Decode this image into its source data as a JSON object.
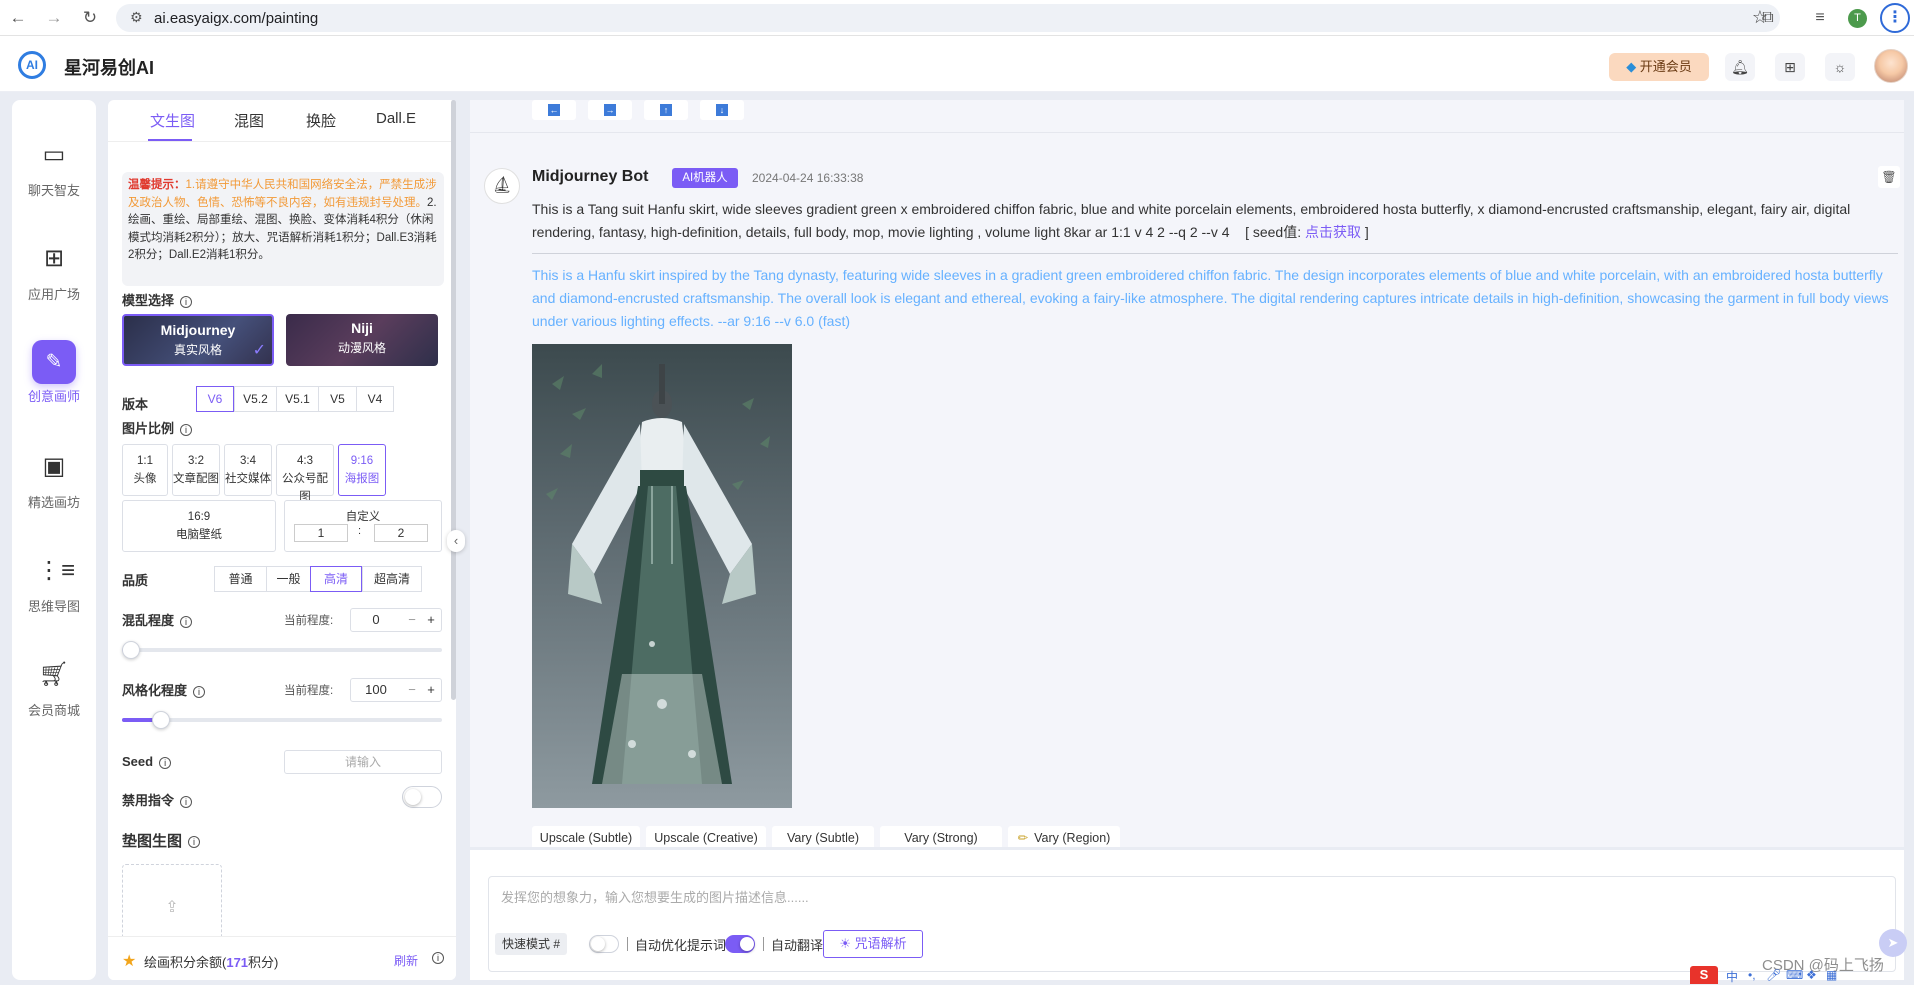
{
  "browser": {
    "url": "ai.easyaigx.com/painting",
    "profile_initial": "T",
    "back_icon": "arrow-left",
    "forward_icon": "arrow-right",
    "reload_icon": "reload"
  },
  "app": {
    "name": "星河易创AI",
    "logo_text": "AI",
    "vip_label": "开通会员"
  },
  "left_nav": [
    {
      "label": "聊天智友",
      "icon": "chat"
    },
    {
      "label": "应用广场",
      "icon": "grid"
    },
    {
      "label": "创意画师",
      "icon": "palette",
      "active": true
    },
    {
      "label": "精选画坊",
      "icon": "gallery"
    },
    {
      "label": "思维导图",
      "icon": "mindmap"
    },
    {
      "label": "会员商城",
      "icon": "cart"
    }
  ],
  "settings": {
    "tabs": [
      "文生图",
      "混图",
      "换脸",
      "Dall.E"
    ],
    "notice": {
      "title": "温馨提示：",
      "warn": "1.请遵守中华人民共和国网络安全法，严禁生成涉及政治人物、色情、恐怖等不良内容，如有违规封号处理。",
      "body": "2.绘画、重绘、局部重绘、混图、换脸、变体消耗4积分（休闲模式均消耗2积分）；放大、咒语解析消耗1积分；Dall.E3消耗2积分；Dall.E2消耗1积分。"
    },
    "model_label": "模型选择",
    "models": [
      {
        "name": "Midjourney",
        "sub": "真实风格",
        "selected": true
      },
      {
        "name": "Niji",
        "sub": "动漫风格",
        "selected": false
      }
    ],
    "version_label": "版本",
    "versions": [
      "V6",
      "V5.2",
      "V5.1",
      "V5",
      "V4"
    ],
    "version_selected": "V6",
    "ratio_label": "图片比例",
    "ratios": [
      {
        "ratio": "1:1",
        "name": "头像"
      },
      {
        "ratio": "3:2",
        "name": "文章配图"
      },
      {
        "ratio": "3:4",
        "name": "社交媒体"
      },
      {
        "ratio": "4:3",
        "name": "公众号配图"
      },
      {
        "ratio": "9:16",
        "name": "海报图",
        "selected": true
      }
    ],
    "ratio_wide": {
      "ratio": "16:9",
      "name": "电脑壁纸"
    },
    "ratio_custom": {
      "label": "自定义",
      "w": "1",
      "h": "2",
      "sep": ":"
    },
    "quality_label": "品质",
    "qualities": [
      "普通",
      "一般",
      "高清",
      "超高清"
    ],
    "quality_selected": "高清",
    "chaos_label": "混乱程度",
    "current_label": "当前程度:",
    "chaos_value": "0",
    "chaos_fraction": 0,
    "stylize_label": "风格化程度",
    "stylize_value": "100",
    "stylize_fraction": 0.1,
    "seed_label": "Seed",
    "seed_placeholder": "请输入",
    "disable_label": "禁用指令",
    "disable_on": false,
    "pad_label": "垫图生图",
    "credits_text": "绘画积分余额(",
    "credits_value": "171",
    "credits_unit": "积分)",
    "refresh_label": "刷新"
  },
  "message": {
    "bot_name": "Midjourney Bot",
    "badge": "AI机器人",
    "time": "2024-04-24 16:33:38",
    "prompt": "This is a Tang suit Hanfu skirt, wide sleeves gradient green x embroidered chiffon fabric, blue and white porcelain elements, embroidered hosta butterfly, x diamond-encrusted craftsmanship, elegant, fairy air, digital rendering, fantasy, high-definition, details, full body, mop, movie lighting , volume light 8kar ar 1:1 v 4 2 --q 2 --v 4",
    "seed_prefix": "[ seed值: ",
    "seed_link": "点击获取",
    "seed_suffix": " ]",
    "translation": "This is a Hanfu skirt inspired by the Tang dynasty, featuring wide sleeves in a gradient green embroidered chiffon fabric. The design incorporates elements of blue and white porcelain, with an embroidered hosta butterfly and diamond-encrusted craftsmanship. The overall look is elegant and ethereal, evoking a fairy-like atmosphere. The digital rendering captures intricate details in high-definition, showcasing the garment in full body views under various lighting effects. --ar 9:16 --v 6.0  (fast)",
    "actions": [
      "Upscale (Subtle)",
      "Upscale (Creative)",
      "Vary (Subtle)",
      "Vary (Strong)",
      "Vary (Region)"
    ],
    "prev_buttons": [
      "←",
      "→",
      "↑",
      "↓"
    ]
  },
  "composer": {
    "placeholder": "发挥您的想象力，输入您想要生成的图片描述信息......",
    "fast_mode": "快速模式 #",
    "auto_optimize": "自动优化提示词",
    "auto_optimize_on": false,
    "auto_translate": "自动翻译",
    "auto_translate_on": true,
    "mantra": "咒语解析"
  },
  "watermark": "CSDN @码上飞扬",
  "colors": {
    "accent": "#7b5cf5",
    "translation": "#66b1ff",
    "warning": "#f29a38",
    "danger": "#e03a2f"
  }
}
